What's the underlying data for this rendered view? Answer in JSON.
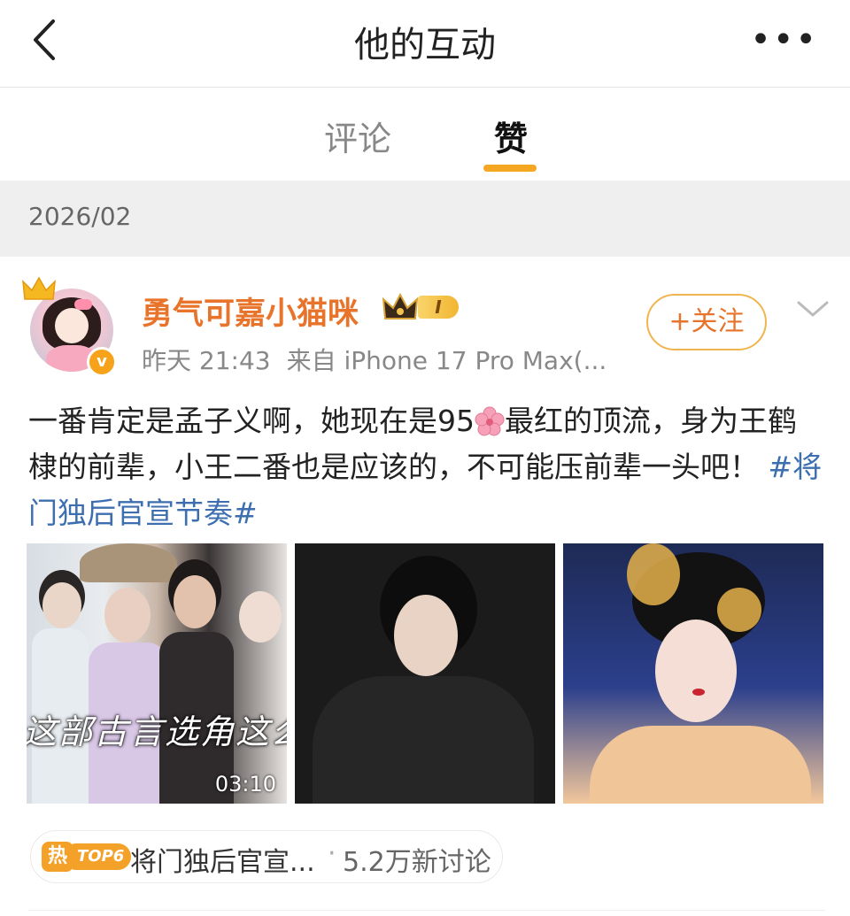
{
  "header": {
    "title": "他的互动",
    "back_icon": "chevron-left-icon",
    "more_label": "•••"
  },
  "tabs": [
    {
      "label": "评论",
      "active": false
    },
    {
      "label": "赞",
      "active": true
    }
  ],
  "accent_color": "#f5a623",
  "date_section": {
    "label": "2026/02"
  },
  "post": {
    "author": {
      "name": "勇气可嘉小猫咪",
      "vip_level": "I",
      "verified_mark": "v"
    },
    "meta": {
      "time": "昨天 21:43",
      "source": "来自 iPhone 17 Pro Max(..."
    },
    "follow_label": "+关注",
    "text_part1": "一番肯定是孟子义啊，她现在是95",
    "text_part2": "最红的顶流，身为王鹤棣的前辈，小王二番也是应该的，不可能压前辈一头吧！",
    "hashtag": "#将门独后官宣节奏#",
    "images": [
      {
        "overlay_text": "这部古言选角这么难",
        "duration": "03:10"
      },
      {},
      {}
    ],
    "topic": {
      "hot_label": "热",
      "badge": "TOP6",
      "title": "将门独后官宣...",
      "dot": "·",
      "count": "5.2万新讨论"
    }
  }
}
